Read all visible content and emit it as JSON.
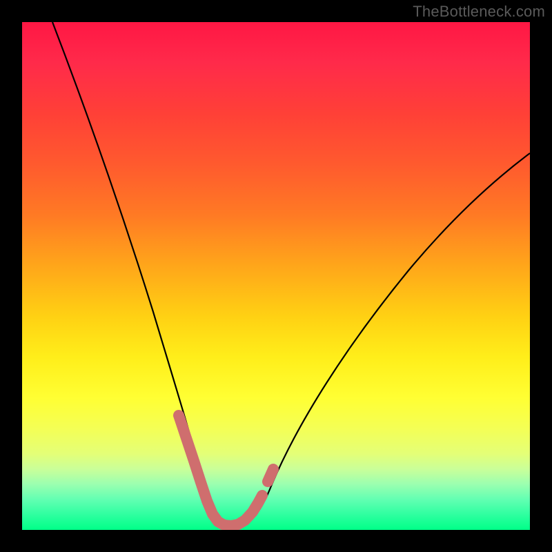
{
  "watermark": "TheBottleneck.com",
  "chart_data": {
    "type": "line",
    "title": "",
    "xlabel": "",
    "ylabel": "",
    "xlim": [
      0,
      100
    ],
    "ylim": [
      0,
      100
    ],
    "series": [
      {
        "name": "bottleneck-curve",
        "x": [
          6,
          10,
          14,
          18,
          22,
          25,
          28,
          30,
          32,
          34,
          36,
          38,
          40,
          43,
          46,
          50,
          55,
          60,
          66,
          72,
          79,
          86,
          93,
          100
        ],
        "values": [
          100,
          86,
          73,
          61,
          50,
          41,
          32,
          25,
          18,
          12,
          7,
          3,
          1,
          1,
          3,
          7,
          13,
          20,
          28,
          36,
          44,
          52,
          59,
          66
        ]
      }
    ],
    "highlight_points": {
      "name": "highlighted-segment",
      "color": "#d26b6b",
      "x": [
        30,
        32,
        34,
        36,
        38,
        40,
        42,
        44,
        46,
        47.5
      ],
      "values": [
        25,
        18,
        12,
        7,
        3,
        1,
        1,
        2,
        3,
        5
      ]
    },
    "gradient_stops": [
      {
        "pos": 0,
        "color": "#ff1744"
      },
      {
        "pos": 50,
        "color": "#ffee1a"
      },
      {
        "pos": 100,
        "color": "#00ff88"
      }
    ]
  }
}
